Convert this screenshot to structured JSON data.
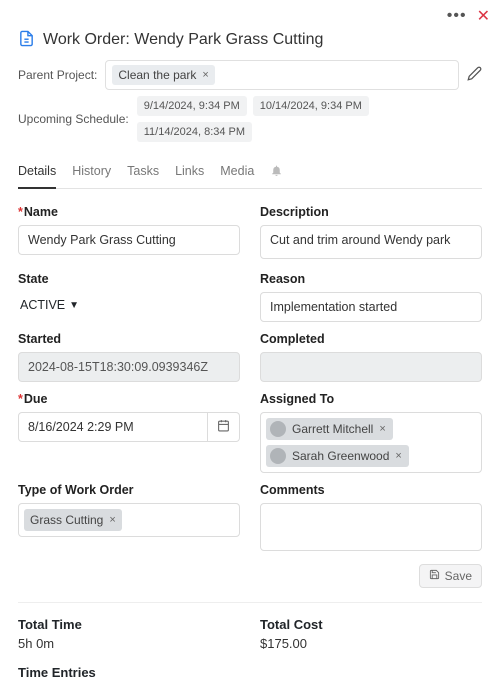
{
  "header": {
    "title": "Work Order: Wendy Park Grass Cutting"
  },
  "parent": {
    "label": "Parent Project:",
    "chip": "Clean the park"
  },
  "schedule": {
    "label": "Upcoming Schedule:",
    "items": [
      "9/14/2024, 9:34 PM",
      "10/14/2024, 9:34 PM",
      "11/14/2024, 8:34 PM"
    ]
  },
  "tabs": {
    "details": "Details",
    "history": "History",
    "tasks": "Tasks",
    "links": "Links",
    "media": "Media"
  },
  "form": {
    "name_label": "Name",
    "name_value": "Wendy Park Grass Cutting",
    "desc_label": "Description",
    "desc_value": "Cut and trim around Wendy park",
    "state_label": "State",
    "state_value": "ACTIVE",
    "reason_label": "Reason",
    "reason_value": "Implementation started",
    "started_label": "Started",
    "started_value": "2024-08-15T18:30:09.0939346Z",
    "completed_label": "Completed",
    "completed_value": "",
    "due_label": "Due",
    "due_value": "8/16/2024 2:29 PM",
    "assigned_label": "Assigned To",
    "assigned": [
      "Garrett Mitchell",
      "Sarah Greenwood"
    ],
    "type_label": "Type of Work Order",
    "type_chip": "Grass Cutting",
    "comments_label": "Comments",
    "comments_value": ""
  },
  "save": {
    "label": "Save"
  },
  "totals": {
    "time_label": "Total Time",
    "time_value": "5h 0m",
    "cost_label": "Total Cost",
    "cost_value": "$175.00",
    "entries_label": "Time Entries"
  }
}
